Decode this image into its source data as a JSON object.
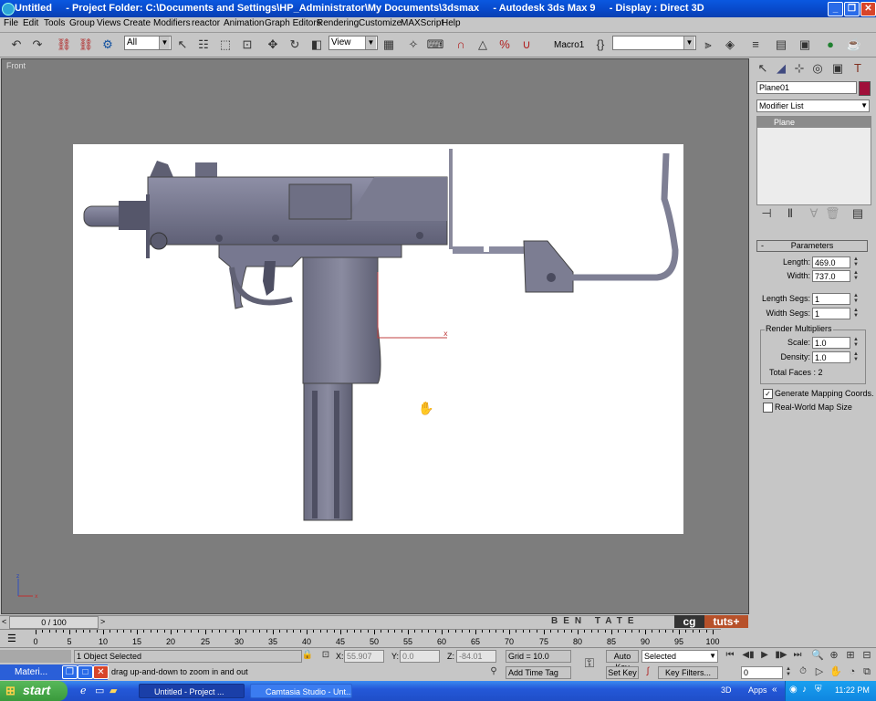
{
  "window": {
    "title": "Untitled     - Project Folder: C:\\Documents and Settings\\HP_Administrator\\My Documents\\3dsmax     - Autodesk 3ds Max 9     - Display : Direct 3D"
  },
  "menu": [
    "File",
    "Edit",
    "Tools",
    "Group",
    "Views",
    "Create",
    "Modifiers",
    "reactor",
    "Animation",
    "Graph Editors",
    "Rendering",
    "Customize",
    "MAXScript",
    "Help"
  ],
  "toolbar": {
    "selection_filter": "All",
    "reference_coord": "View",
    "macro_label": "Macro1",
    "named_selection": ""
  },
  "viewport": {
    "label": "Front"
  },
  "command_panel": {
    "object_name": "Plane01",
    "object_color": "#a0103a",
    "modifier_list": "Modifier List",
    "stack_item": "Plane",
    "rollout_title": "Parameters",
    "length_label": "Length:",
    "length_value": "469.0",
    "width_label": "Width:",
    "width_value": "737.0",
    "length_segs_label": "Length Segs:",
    "length_segs_value": "1",
    "width_segs_label": "Width Segs:",
    "width_segs_value": "1",
    "render_group": "Render Multipliers",
    "scale_label": "Scale:",
    "scale_value": "1.0",
    "density_label": "Density:",
    "density_value": "1.0",
    "total_faces": "Total Faces : 2",
    "gen_mapping": "Generate Mapping Coords.",
    "gen_mapping_checked": true,
    "real_world": "Real-World Map Size",
    "real_world_checked": false
  },
  "timeline": {
    "frame": "0 / 100",
    "ticks": [
      "0",
      "5",
      "10",
      "15",
      "20",
      "25",
      "30",
      "35",
      "40",
      "45",
      "50",
      "55",
      "60",
      "65",
      "70",
      "75",
      "80",
      "85",
      "90",
      "95",
      "100"
    ]
  },
  "watermark": {
    "name": "BEN TATE",
    "brand1": "cg",
    "brand2": "tuts+"
  },
  "status": {
    "selection": "1 Object Selected",
    "prompt": "drag up-and-down to zoom in and out",
    "x_label": "X:",
    "x_value": "55.907",
    "y_label": "Y:",
    "y_value": "0.0",
    "z_label": "Z:",
    "z_value": "-84.01",
    "grid": "Grid = 10.0",
    "add_time_tag": "Add Time Tag",
    "auto_key": "Auto Key",
    "key_mode": "Selected",
    "set_key": "Set Key",
    "key_filters": "Key Filters...",
    "frame_field": "0",
    "maxscript_label": "Materi..."
  },
  "taskbar": {
    "start": "start",
    "tasks": [
      "Untitled     - Project ...",
      "Camtasia Studio - Unt..."
    ],
    "tray_3d": "3D",
    "tray_apps": "Apps",
    "clock": "11:22 PM"
  }
}
